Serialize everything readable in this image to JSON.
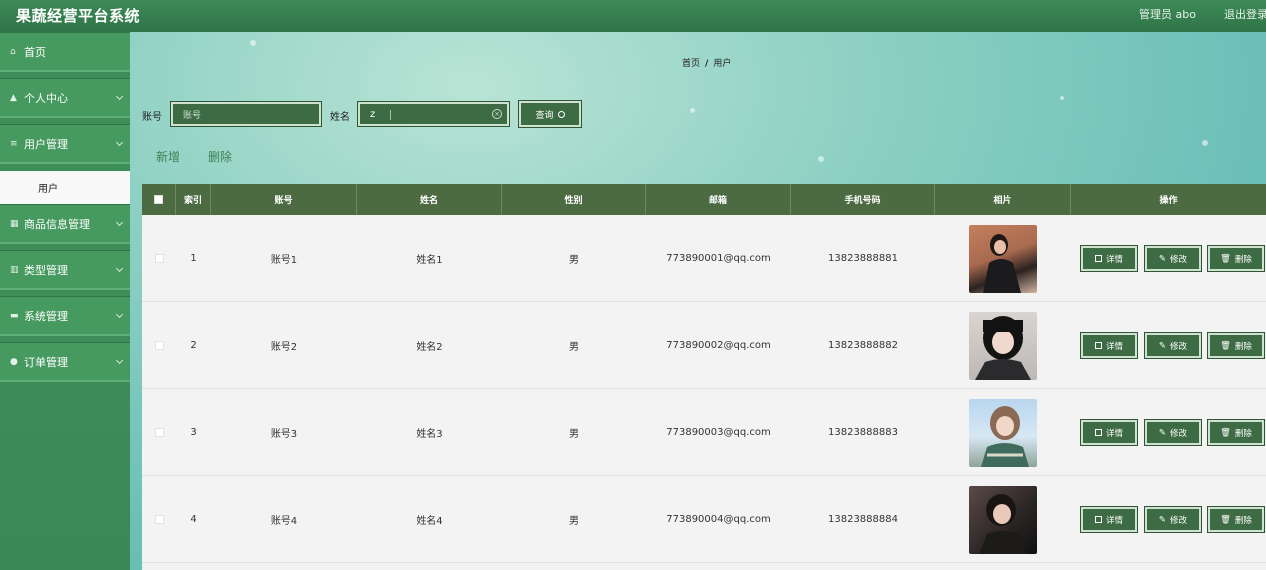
{
  "header": {
    "title": "果蔬经营平台系统",
    "user_label": "管理员 abo",
    "logout": "退出登录"
  },
  "sidebar": {
    "items": [
      {
        "icon": "home-icon",
        "glyph": "⌂",
        "label": "首页",
        "has_children": false
      },
      {
        "icon": "person-icon",
        "glyph": "▲",
        "label": "个人中心",
        "has_children": true
      },
      {
        "icon": "list-icon",
        "glyph": "≡",
        "label": "用户管理",
        "has_children": true
      },
      {
        "icon": "grid-icon",
        "glyph": "▦",
        "label": "商品信息管理",
        "has_children": true
      },
      {
        "icon": "chart-icon",
        "glyph": "▥",
        "label": "类型管理",
        "has_children": true
      },
      {
        "icon": "system-icon",
        "glyph": "▬",
        "label": "系统管理",
        "has_children": true
      },
      {
        "icon": "pin-icon",
        "glyph": "●",
        "label": "订单管理",
        "has_children": true
      }
    ],
    "sub_item": "用户"
  },
  "breadcrumb": {
    "home": "首页",
    "sep": "/",
    "current": "用户"
  },
  "search": {
    "account_label": "账号",
    "account_placeholder": "账号",
    "account_value": "",
    "name_label": "姓名",
    "name_value": "z",
    "query_button": "查询"
  },
  "actions": {
    "add": "新增",
    "delete": "删除"
  },
  "table": {
    "headers": {
      "index": "索引",
      "account": "账号",
      "name": "姓名",
      "gender": "性别",
      "email": "邮箱",
      "phone": "手机号码",
      "photo": "相片",
      "ops": "操作"
    },
    "rows": [
      {
        "index": "1",
        "account": "账号1",
        "name": "姓名1",
        "gender": "男",
        "email": "773890001@qq.com",
        "phone": "13823888881"
      },
      {
        "index": "2",
        "account": "账号2",
        "name": "姓名2",
        "gender": "男",
        "email": "773890002@qq.com",
        "phone": "13823888882"
      },
      {
        "index": "3",
        "account": "账号3",
        "name": "姓名3",
        "gender": "男",
        "email": "773890003@qq.com",
        "phone": "13823888883"
      },
      {
        "index": "4",
        "account": "账号4",
        "name": "姓名4",
        "gender": "男",
        "email": "773890004@qq.com",
        "phone": "13823888884"
      }
    ],
    "ops": {
      "detail": "详情",
      "edit": "修改",
      "remove": "删除"
    }
  },
  "colors": {
    "header": "#2f7448",
    "sidebar": "#469a60",
    "table_head": "#4d6b43",
    "button": "#3d6b44",
    "accent_text": "#3e7f55"
  }
}
